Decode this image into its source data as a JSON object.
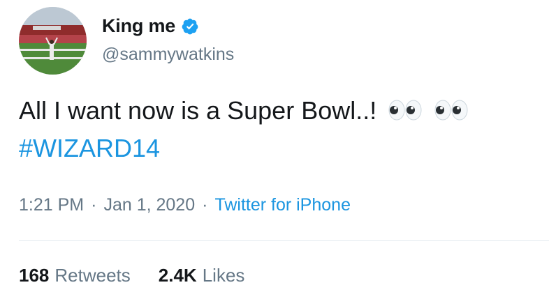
{
  "author": {
    "display_name": "King me",
    "handle": "@sammywatkins",
    "verified_icon": "verified-badge-icon",
    "avatar_icon": "stadium-photo-avatar"
  },
  "tweet": {
    "text_line1": "All I want now is a Super Bowl..!",
    "emoji": [
      "eyes-emoji",
      "eyes-emoji"
    ],
    "hashtag": "#WIZARD14"
  },
  "meta": {
    "time": "1:21 PM",
    "separator": "·",
    "date": "Jan 1, 2020",
    "source": "Twitter for iPhone"
  },
  "stats": {
    "retweets_count": "168",
    "retweets_label": "Retweets",
    "likes_count": "2.4K",
    "likes_label": "Likes"
  },
  "colors": {
    "link": "#1b95e0",
    "secondary_text": "#657786",
    "primary_text": "#14171a",
    "verified": "#1da1f2"
  }
}
